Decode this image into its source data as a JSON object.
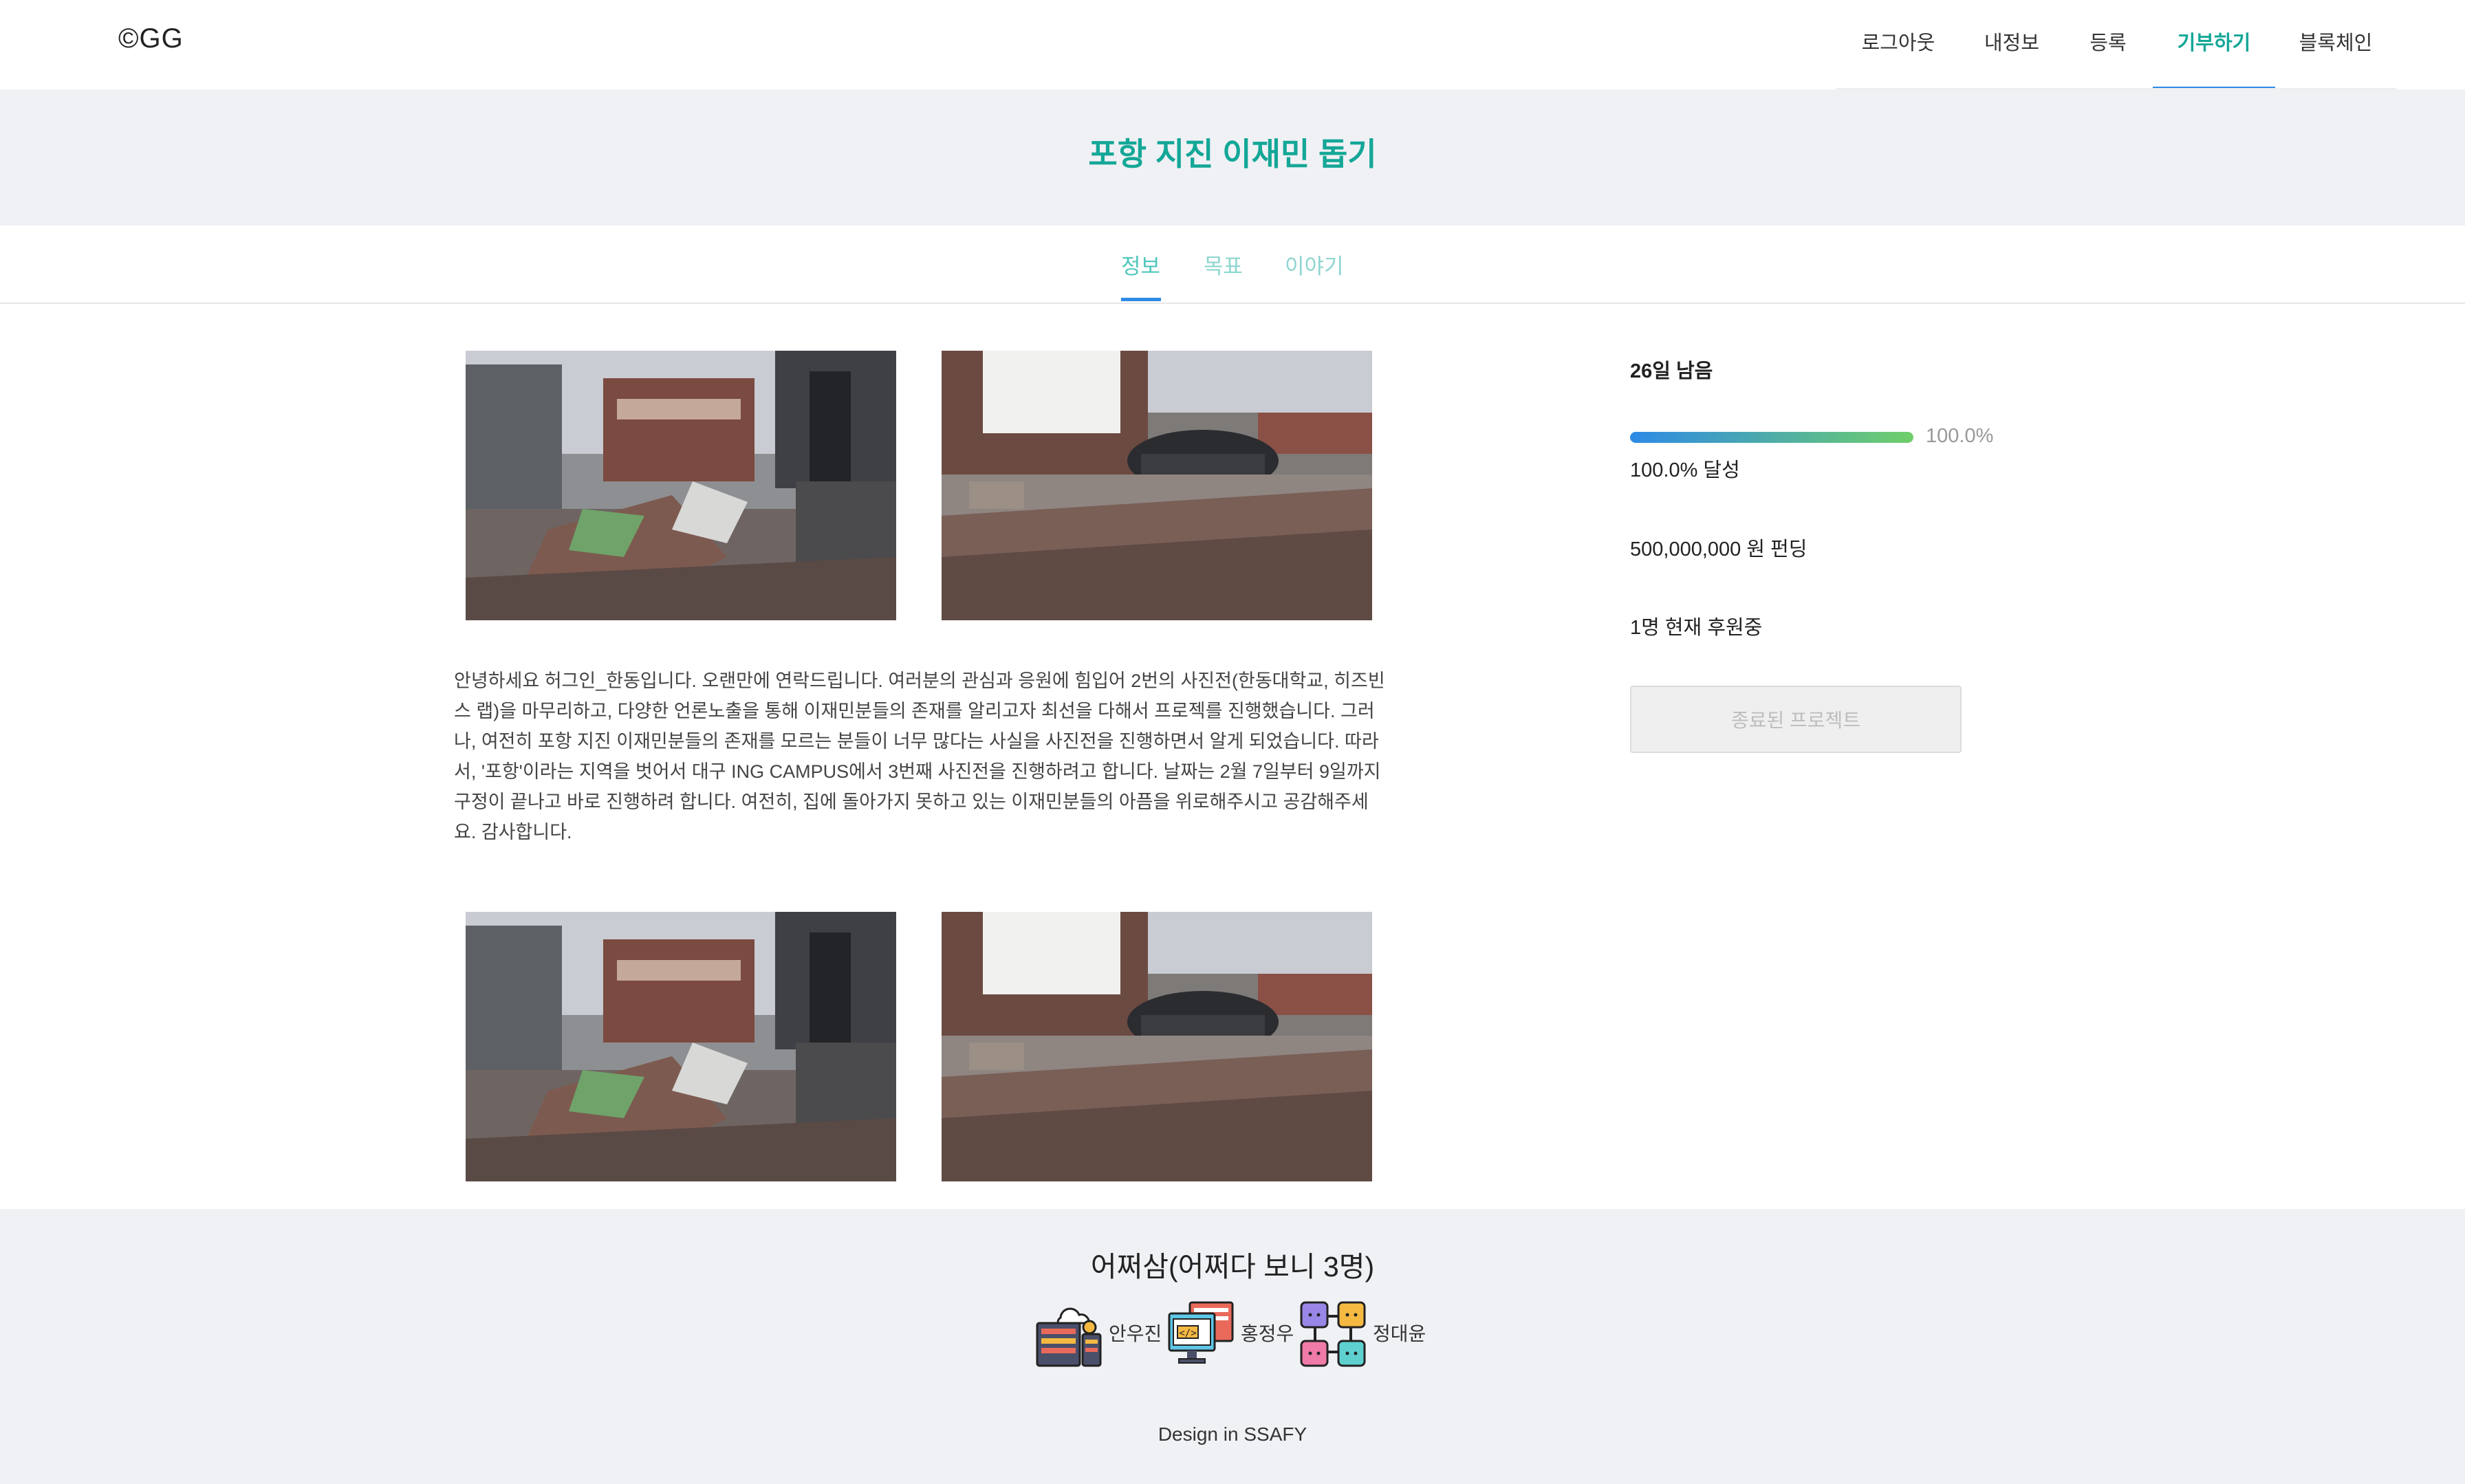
{
  "logo": "©GG",
  "nav": {
    "items": [
      {
        "label": "로그아웃"
      },
      {
        "label": "내정보"
      },
      {
        "label": "등록"
      },
      {
        "label": "기부하기",
        "active": true
      },
      {
        "label": "블록체인"
      }
    ]
  },
  "campaign": {
    "title": "포항 지진 이재민 돕기"
  },
  "tabs": [
    {
      "label": "정보",
      "active": true
    },
    {
      "label": "목표"
    },
    {
      "label": "이야기"
    }
  ],
  "story": "안녕하세요 허그인_한동입니다. 오랜만에 연락드립니다. 여러분의 관심과 응원에 힘입어 2번의 사진전(한동대학교, 히즈빈스 랩)을 마무리하고, 다양한 언론노출을 통해 이재민분들의 존재를 알리고자 최선을 다해서 프로젝를 진행했습니다. 그러나, 여전히 포항 지진 이재민분들의 존재를 모르는 분들이 너무 많다는 사실을 사진전을 진행하면서 알게 되었습니다. 따라서, '포항'이라는 지역을 벗어서 대구 ING CAMPUS에서 3번째 사진전을 진행하려고 합니다. 날짜는 2월 7일부터 9일까지 구정이 끝나고 바로 진행하려 합니다. 여전히, 집에 돌아가지 못하고 있는 이재민분들의 아픔을 위로해주시고 공감해주세요. 감사합니다.",
  "sidebar": {
    "days_left": "26일 남음",
    "progress_fraction": 1.0,
    "progress_percent": "100.0%",
    "achieved": "100.0% 달성",
    "funding": "500,000,000 원 펀딩",
    "supporters": "1명 현재 후원중",
    "ended_button": "종료된 프로젝트"
  },
  "footer": {
    "team": "어쩌삼(어쩌다 보니 3명)",
    "members": [
      {
        "name": "안우진",
        "icon": "server-cloud-icon"
      },
      {
        "name": "홍정우",
        "icon": "code-monitor-icon"
      },
      {
        "name": "정대윤",
        "icon": "network-nodes-icon"
      }
    ],
    "credit": "Design in SSAFY"
  },
  "colors": {
    "accent": "#14a797",
    "tab_active": "#4fc7bb",
    "underline": "#2d8ae6",
    "band_bg": "#f0f1f5"
  }
}
